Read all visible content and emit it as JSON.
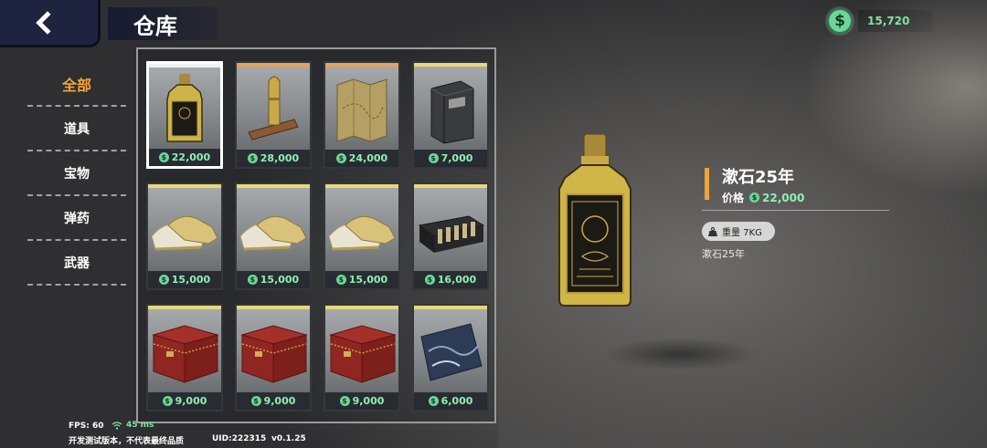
{
  "header": {
    "title": "仓库",
    "currency_symbol": "$",
    "currency_value": "15,720"
  },
  "categories": [
    {
      "label": "全部",
      "active": true
    },
    {
      "label": "道具",
      "active": false
    },
    {
      "label": "宝物",
      "active": false
    },
    {
      "label": "弹药",
      "active": false
    },
    {
      "label": "武器",
      "active": false
    }
  ],
  "items": [
    {
      "icon": "whiskey-bottle-icon",
      "price": "22,000",
      "strip": "#f0f0f0",
      "selected": true
    },
    {
      "icon": "bullet-icon",
      "price": "28,000",
      "strip": "#e8a15a",
      "selected": false
    },
    {
      "icon": "treasure-map-icon",
      "price": "24,000",
      "strip": "#e8a15a",
      "selected": false
    },
    {
      "icon": "gift-box-icon",
      "price": "7,000",
      "strip": "#e6d97a",
      "selected": false
    },
    {
      "icon": "sneakers-icon",
      "price": "15,000",
      "strip": "#e6d97a",
      "selected": false
    },
    {
      "icon": "sneakers-icon",
      "price": "15,000",
      "strip": "#e6d97a",
      "selected": false
    },
    {
      "icon": "sneakers-icon",
      "price": "15,000",
      "strip": "#e6d97a",
      "selected": false
    },
    {
      "icon": "tea-set-icon",
      "price": "16,000",
      "strip": "#e6d97a",
      "selected": false
    },
    {
      "icon": "red-chest-icon",
      "price": "9,000",
      "strip": "#e6d97a",
      "selected": false
    },
    {
      "icon": "red-chest-icon",
      "price": "9,000",
      "strip": "#e6d97a",
      "selected": false
    },
    {
      "icon": "red-chest-icon",
      "price": "9,000",
      "strip": "#e6d97a",
      "selected": false
    },
    {
      "icon": "painting-icon",
      "price": "6,000",
      "strip": "#e6d97a",
      "selected": false
    }
  ],
  "detail": {
    "name": "漱石25年",
    "price_label": "价格",
    "price": "22,000",
    "weight": "重量 7KG",
    "description": "漱石25年"
  },
  "footer": {
    "fps": "FPS: 60",
    "ping": "45 ms",
    "note": "开发测试版本，不代表最终品质",
    "uid": "UID:222315",
    "version": "v0.1.25"
  },
  "colors": {
    "accent_orange": "#f0a33b",
    "money_green": "#8ff0b4",
    "rare_orange": "#e8a15a",
    "common_yellow": "#e6d97a"
  }
}
